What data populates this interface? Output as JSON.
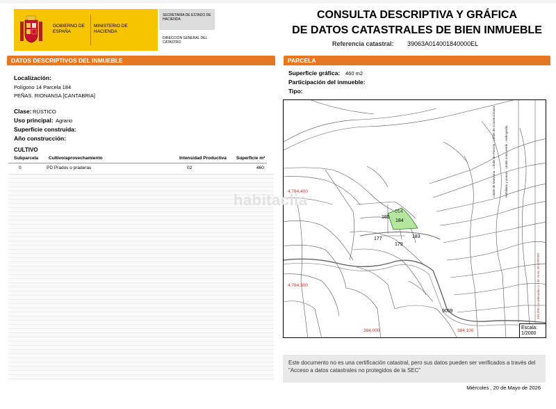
{
  "header": {
    "gov_line1": "GOBIERNO DE ESPAÑA",
    "gov_line2": "MINISTERIO DE HACIENDA",
    "secretaria": "SECRETARÍA DE ESTADO DE HACIENDA",
    "direccion": "DIRECCIÓN GENERAL DEL CATASTRO",
    "title_line1": "CONSULTA DESCRIPTIVA Y GRÁFICA",
    "title_line2": "DE DATOS CATASTRALES DE BIEN INMUEBLE",
    "ref_label": "Referencia catastral:",
    "ref_value": "39063A014001840000EL"
  },
  "left": {
    "section_title": "DATOS DESCRIPTIVOS DEL INMUEBLE",
    "localizacion_label": "Localización:",
    "localizacion_line1": "Polígono 14 Parcela 184",
    "localizacion_line2": "PEÑAS. RIONANSA [CANTABRIA]",
    "clase_label": "Clase:",
    "clase_value": "RÚSTICO",
    "uso_label": "Uso principal:",
    "uso_value": "Agrario",
    "superficie_label": "Superficie construida:",
    "anio_label": "Año construcción:",
    "cultivo_title": "CULTIVO",
    "table": {
      "headers": [
        "Subparcela",
        "Cultivo/aprovechamiento",
        "Intensidad Productiva",
        "Superficie m²"
      ],
      "rows": [
        [
          "0",
          "PD Prados o praderas",
          "02",
          "460"
        ]
      ]
    }
  },
  "right": {
    "section_title": "PARCELA",
    "sup_grafica_label": "Superficie gráfica:",
    "sup_grafica_value": "460 m2",
    "participacion_label": "Participación del inmueble:",
    "tipo_label": "Tipo:",
    "map": {
      "parcels": [
        "184",
        "014",
        "185",
        "177",
        "179",
        "183"
      ],
      "coords": [
        "4.784.400",
        "4.784.300",
        "384.000",
        "384.100"
      ],
      "road": "9009",
      "legend_left": [
        "Límite de Manzana",
        "Límite de Parcela",
        "Límite de Construcciones",
        "Mobiliario y aceras",
        "Límite zona verde",
        "Hidrografía"
      ],
      "legend_right": "384,200 Coordenadas U.T.M. Huso 30 ETRS89",
      "scale_label": "Escala:",
      "scale_value": "1/2000"
    },
    "note": "Este documento no es una certificación catastral, pero sus datos pueden ser verificados a través del \"Acceso a datos catastrales no protegidos de la SEC\"",
    "date": "Miércoles , 20 de Mayo de 2026"
  },
  "watermark": "habitaclia",
  "colors": {
    "accent": "#e87722",
    "gov_yellow": "#f7c400",
    "parcel_green": "#b4e6a0"
  }
}
